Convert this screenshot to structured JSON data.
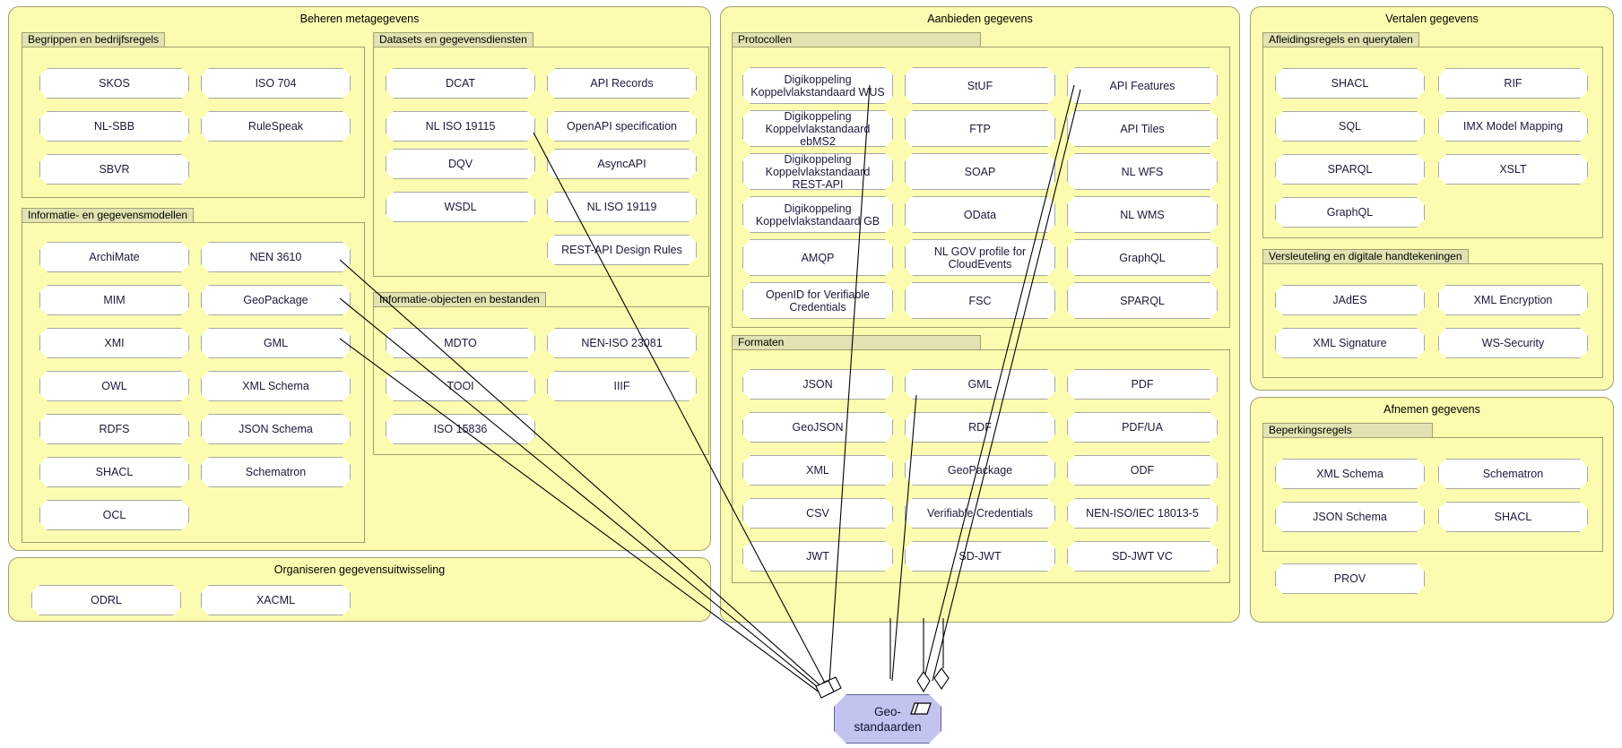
{
  "diagram": {
    "title": "Geo-standaarden relatieoverzicht",
    "focus_element": {
      "label_line1": "Geo-",
      "label_line2": "standaarden",
      "icon": "representation-icon",
      "fill": "#c3c3f0",
      "stroke": "#60609a"
    },
    "colors": {
      "group_fill": "#fcfcb0",
      "group_stroke": "#a0a070",
      "subgroup_tab_fill": "#e2e2b2",
      "node_fill": "#ffffff",
      "node_stroke": "#a8a8a8",
      "focus_fill": "#c3c3f0"
    }
  },
  "groups": [
    {
      "id": "beheren-metagegevens",
      "title": "Beheren metagegevens",
      "subgroups": [
        {
          "id": "begrippen-en-bedrijfsregels",
          "title": "Begrippen en bedrijfsregels",
          "nodes": [
            "SKOS",
            "ISO 704",
            "NL-SBB",
            "RuleSpeak",
            "SBVR"
          ]
        },
        {
          "id": "informatie-en-gegevensmodellen",
          "title": "Informatie- en gegevensmodellen",
          "nodes": [
            "ArchiMate",
            "NEN 3610",
            "MIM",
            "GeoPackage",
            "XMI",
            "GML",
            "OWL",
            "XML Schema",
            "RDFS",
            "JSON Schema",
            "SHACL",
            "Schematron",
            "OCL"
          ]
        },
        {
          "id": "datasets-en-gegevensdiensten",
          "title": "Datasets en gegevensdiensten",
          "nodes": [
            "DCAT",
            "API Records",
            "NL ISO 19115",
            "OpenAPI specification",
            "DQV",
            "AsyncAPI",
            "WSDL",
            "NL ISO 19119",
            "REST-API Design Rules"
          ]
        },
        {
          "id": "informatie-objecten-en-bestanden",
          "title": "Informatie-objecten en bestanden",
          "nodes": [
            "MDTO",
            "NEN-ISO 23081",
            "TOOI",
            "IIIF",
            "ISO 15836"
          ]
        }
      ]
    },
    {
      "id": "organiseren-gegevensuitwisseling",
      "title": "Organiseren gegevensuitwisseling",
      "subgroups": [],
      "nodes": [
        "ODRL",
        "XACML"
      ]
    },
    {
      "id": "aanbieden-gegevens",
      "title": "Aanbieden gegevens",
      "subgroups": [
        {
          "id": "protocollen",
          "title": "Protocollen",
          "nodes": [
            "Digikoppeling Koppelvlakstandaard WUS",
            "StUF",
            "API Features",
            "Digikoppeling Koppelvlakstandaard ebMS2",
            "FTP",
            "API Tiles",
            "Digikoppeling Koppelvlakstandaard REST-API",
            "SOAP",
            "NL WFS",
            "Digikoppeling Koppelvlakstandaard GB",
            "OData",
            "NL WMS",
            "AMQP",
            "NL GOV profile for CloudEvents",
            "GraphQL",
            "OpenID for Verifiable Credentials",
            "FSC",
            "SPARQL"
          ]
        },
        {
          "id": "formaten",
          "title": "Formaten",
          "nodes": [
            "JSON",
            "GML",
            "PDF",
            "GeoJSON",
            "RDF",
            "PDF/UA",
            "XML",
            "GeoPackage",
            "ODF",
            "CSV",
            "Verifiable Credentials",
            "NEN-ISO/IEC 18013-5",
            "JWT",
            "SD-JWT",
            "SD-JWT VC"
          ]
        }
      ]
    },
    {
      "id": "vertalen-gegevens",
      "title": "Vertalen gegevens",
      "subgroups": [
        {
          "id": "afleidingsregels-en-querytalen",
          "title": "Afleidingsregels en querytalen",
          "nodes": [
            "SHACL",
            "RIF",
            "SQL",
            "IMX Model Mapping",
            "SPARQL",
            "XSLT",
            "GraphQL"
          ]
        },
        {
          "id": "versleuteling-en-digitale-handtekeningen",
          "title": "Versleuteling en digitale handtekeningen",
          "nodes": [
            "JAdES",
            "XML Encryption",
            "XML Signature",
            "WS-Security"
          ]
        }
      ]
    },
    {
      "id": "afnemen-gegevens",
      "title": "Afnemen gegevens",
      "subgroups": [
        {
          "id": "beperkingsregels",
          "title": "Beperkingsregels",
          "nodes": [
            "XML Schema",
            "Schematron",
            "JSON Schema",
            "SHACL"
          ]
        }
      ],
      "nodes": [
        "PROV"
      ]
    }
  ],
  "nodes": {
    "skos": "SKOS",
    "iso704": "ISO 704",
    "nlsbb": "NL-SBB",
    "rulespeak": "RuleSpeak",
    "sbvr": "SBVR",
    "archimate": "ArchiMate",
    "nen3610": "NEN 3610",
    "mim": "MIM",
    "geopackage": "GeoPackage",
    "xmi": "XMI",
    "gml": "GML",
    "owl": "OWL",
    "xmlschema": "XML Schema",
    "rdfs": "RDFS",
    "jsonschema": "JSON Schema",
    "shacl": "SHACL",
    "schematron": "Schematron",
    "ocl": "OCL",
    "dcat": "DCAT",
    "apirecords": "API Records",
    "nliso19115": "NL ISO 19115",
    "openapi": "OpenAPI specification",
    "dqv": "DQV",
    "asyncapi": "AsyncAPI",
    "wsdl": "WSDL",
    "nliso19119": "NL ISO 19119",
    "restapidesignrules": "REST-API Design Rules",
    "mdto": "MDTO",
    "neniso23081": "NEN-ISO 23081",
    "tooi": "TOOI",
    "iiif": "IIIF",
    "iso15836": "ISO 15836",
    "odrl": "ODRL",
    "xacml": "XACML",
    "dk_wus": "Digikoppeling Koppelvlakstandaard WUS",
    "stuf": "StUF",
    "apifeatures": "API Features",
    "dk_ebms2": "Digikoppeling Koppelvlakstandaard ebMS2",
    "ftp": "FTP",
    "apitiles": "API Tiles",
    "dk_restapi": "Digikoppeling Koppelvlakstandaard REST-API",
    "soap": "SOAP",
    "nlwfs": "NL WFS",
    "dk_gb": "Digikoppeling Koppelvlakstandaard GB",
    "odata": "OData",
    "nlwms": "NL WMS",
    "amqp": "AMQP",
    "cloudevents": "NL GOV profile for CloudEvents",
    "graphql": "GraphQL",
    "openid_vc": "OpenID for Verifiable Credentials",
    "fsc": "FSC",
    "sparql": "SPARQL",
    "json": "JSON",
    "gml2": "GML",
    "pdf": "PDF",
    "geojson": "GeoJSON",
    "rdf": "RDF",
    "pdfua": "PDF/UA",
    "xml": "XML",
    "geopackage2": "GeoPackage",
    "odf": "ODF",
    "csv": "CSV",
    "verifiablecredentials": "Verifiable Credentials",
    "neniso18013": "NEN-ISO/IEC 18013-5",
    "jwt": "JWT",
    "sdjwt": "SD-JWT",
    "sdjwtvc": "SD-JWT VC",
    "shacl2": "SHACL",
    "rif": "RIF",
    "sql": "SQL",
    "imxmodelmapping": "IMX Model Mapping",
    "sparql2": "SPARQL",
    "xslt": "XSLT",
    "graphql2": "GraphQL",
    "jades": "JAdES",
    "xmlencryption": "XML Encryption",
    "xmlsignature": "XML Signature",
    "wssecurity": "WS-Security",
    "xmlschema2": "XML Schema",
    "schematron2": "Schematron",
    "jsonschema2": "JSON Schema",
    "shacl3": "SHACL",
    "prov": "PROV"
  },
  "titles": {
    "beheren": "Beheren metagegevens",
    "organiseren": "Organiseren gegevensuitwisseling",
    "aanbieden": "Aanbieden gegevens",
    "vertalen": "Vertalen gegevens",
    "afnemen": "Afnemen gegevens",
    "begrippen": "Begrippen en bedrijfsregels",
    "informatiemodellen": "Informatie- en gegevensmodellen",
    "datasets": "Datasets en gegevensdiensten",
    "infoobjecten": "Informatie-objecten en bestanden",
    "protocollen": "Protocollen",
    "formaten": "Formaten",
    "afleidingsregels": "Afleidingsregels en querytalen",
    "versleuteling": "Versleuteling en digitale handtekeningen",
    "beperkingsregels": "Beperkingsregels"
  },
  "focus": {
    "line1": "Geo-",
    "line2": "standaarden"
  }
}
